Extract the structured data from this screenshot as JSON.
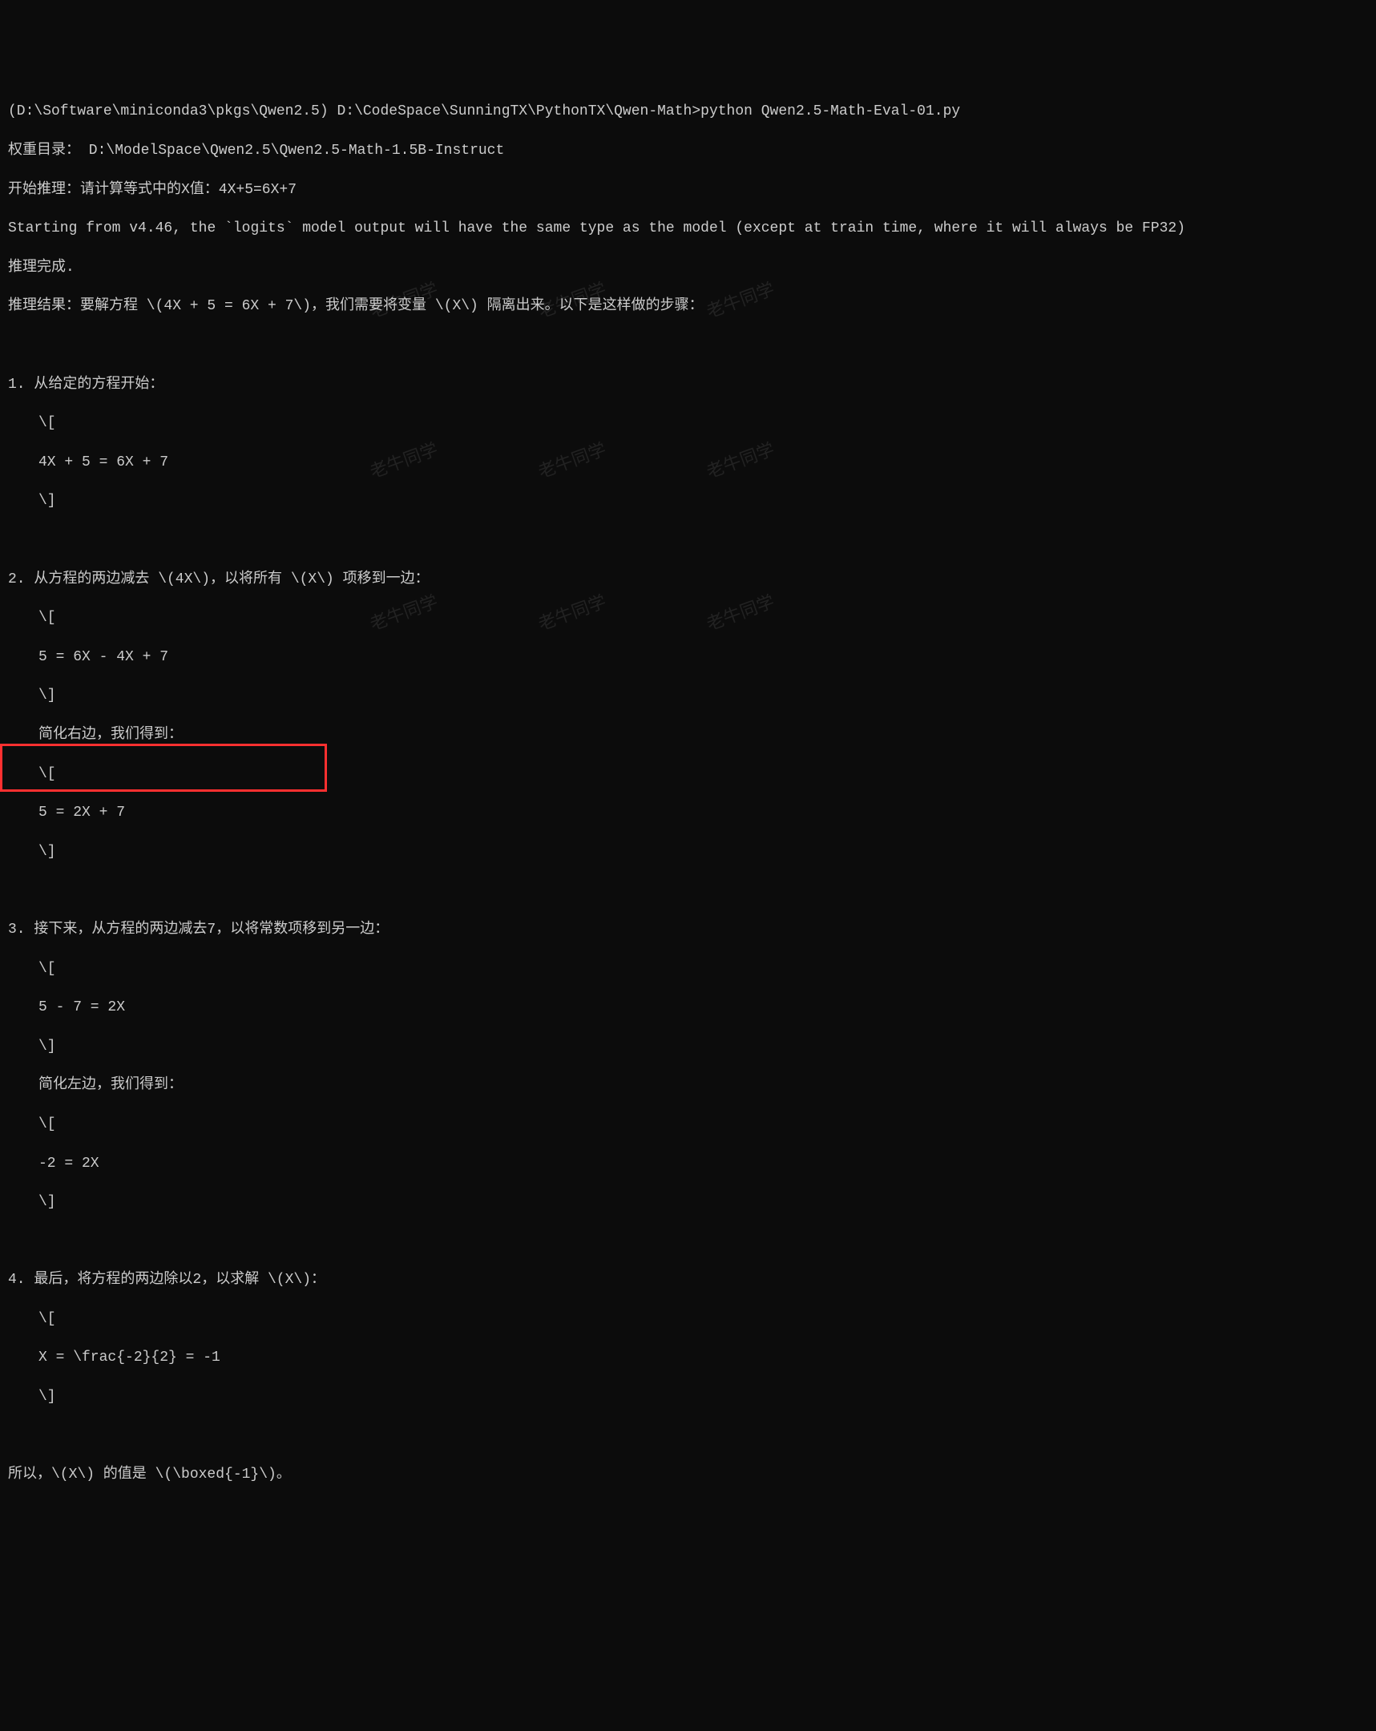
{
  "terminal": {
    "prompt_line": "(D:\\Software\\miniconda3\\pkgs\\Qwen2.5) D:\\CodeSpace\\SunningTX\\PythonTX\\Qwen-Math>python Qwen2.5-Math-Eval-01.py",
    "weight_dir": "权重目录： D:\\ModelSpace\\Qwen2.5\\Qwen2.5-Math-1.5B-Instruct",
    "start_infer": "开始推理：请计算等式中的X值：4X+5=6X+7",
    "warning": "Starting from v4.46, the `logits` model output will have the same type as the model (except at train time, where it will always be FP32)",
    "infer_done": "推理完成.",
    "infer_result_intro": "推理结果：要解方程 \\(4X + 5 = 6X + 7\\)，我们需要将变量 \\(X\\) 隔离出来。以下是这样做的步骤：",
    "step1_header": "1. 从给定的方程开始：",
    "step1_open": "\\[",
    "step1_eq": "4X + 5 = 6X + 7",
    "step1_close": "\\]",
    "step2_header": "2. 从方程的两边减去 \\(4X\\)，以将所有 \\(X\\) 项移到一边：",
    "step2_open": "\\[",
    "step2_eq1": "5 = 6X - 4X + 7",
    "step2_close1": "\\]",
    "step2_simplify": "简化右边，我们得到：",
    "step2_open2": "\\[",
    "step2_eq2": "5 = 2X + 7",
    "step2_close2": "\\]",
    "step3_header": "3. 接下来，从方程的两边减去7，以将常数项移到另一边：",
    "step3_open": "\\[",
    "step3_eq1": "5 - 7 = 2X",
    "step3_close1": "\\]",
    "step3_simplify": "简化左边，我们得到：",
    "step3_open2": "\\[",
    "step3_eq2": "-2 = 2X",
    "step3_close2": "\\]",
    "step4_header": "4. 最后，将方程的两边除以2，以求解 \\(X\\)：",
    "step4_open": "\\[",
    "step4_eq": "X = \\frac{-2}{2} = -1",
    "step4_close": "\\]",
    "conclusion": "所以，\\(X\\) 的值是 \\(\\boxed{-1}\\)。"
  },
  "watermark_text": "老牛同学"
}
